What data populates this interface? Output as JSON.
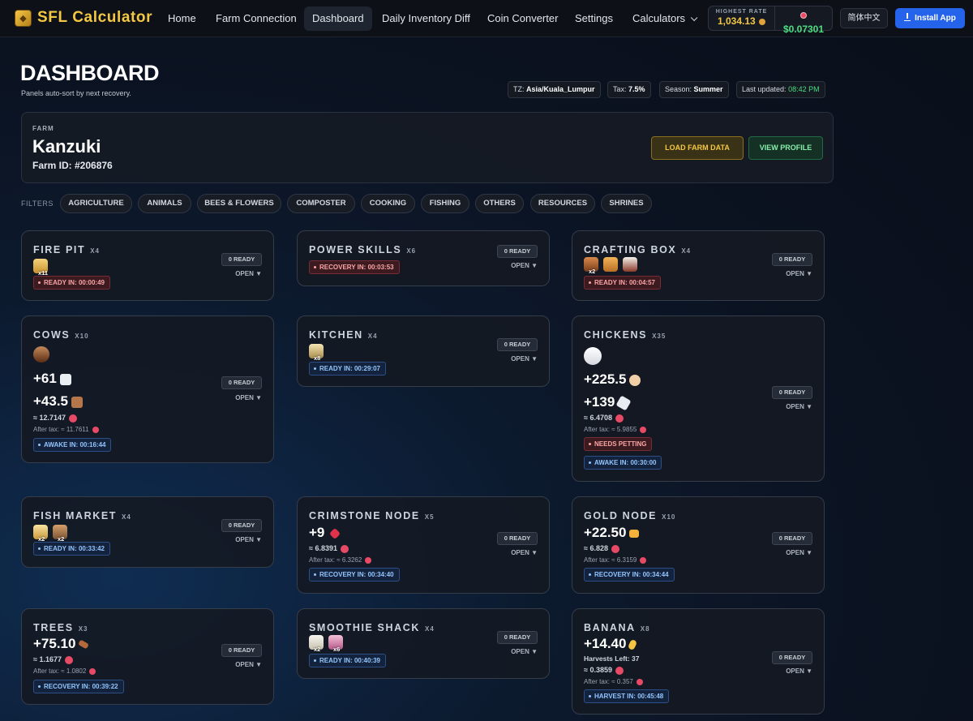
{
  "nav": {
    "logo": "SFL Calculator",
    "links": [
      "Home",
      "Farm Connection",
      "Dashboard",
      "Daily Inventory Diff",
      "Coin Converter",
      "Settings",
      "Calculators"
    ],
    "rate_label": "HIGHEST RATE",
    "rate_value": "1,034.13",
    "usd_value": "$0.07301",
    "lang": "简体中文",
    "install": "Install App"
  },
  "header": {
    "title": "DASHBOARD",
    "subtitle": "Panels auto-sort by next recovery.",
    "chips": {
      "tz_label": "TZ:",
      "tz": "Asia/Kuala_Lumpur",
      "tax_label": "Tax:",
      "tax": "7.5%",
      "season_label": "Season:",
      "season": "Summer",
      "updated_label": "Last updated:",
      "updated": "08:42 PM"
    }
  },
  "farm": {
    "label": "FARM",
    "name": "Kanzuki",
    "id": "Farm ID: #206876",
    "load_btn": "LOAD FARM DATA",
    "view_btn": "VIEW PROFILE"
  },
  "filters": {
    "label": "FILTERS",
    "items": [
      "AGRICULTURE",
      "ANIMALS",
      "BEES & FLOWERS",
      "COMPOSTER",
      "COOKING",
      "FISHING",
      "OTHERS",
      "RESOURCES",
      "SHRINES"
    ]
  },
  "panels": {
    "ready": "0 READY",
    "open": "OPEN ▼",
    "firepit": {
      "title": "FIRE PIT",
      "mult": "X4",
      "items": [
        {
          "icon": "food-bowl-icon",
          "qty": "x11"
        }
      ],
      "status": "READY IN: 00:00:49"
    },
    "power": {
      "title": "POWER SKILLS",
      "mult": "X6",
      "status": "RECOVERY IN: 00:03:53"
    },
    "crafting": {
      "title": "CRAFTING BOX",
      "mult": "X4",
      "items": [
        {
          "icon": "doll-icon",
          "qty": "x2"
        },
        {
          "icon": "bear-doll-icon",
          "qty": ""
        },
        {
          "icon": "figurine-icon",
          "qty": ""
        }
      ],
      "status": "READY IN: 00:04:57"
    },
    "cows": {
      "title": "COWS",
      "mult": "X10",
      "v1": "+61",
      "v2": "+43.5",
      "approx": "≈ 12.7147",
      "tax": "After tax: ≈ 11.7611",
      "status": "AWAKE IN: 00:16:44"
    },
    "kitchen": {
      "title": "KITCHEN",
      "mult": "X4",
      "items": [
        {
          "icon": "dish-icon",
          "qty": "x8"
        }
      ],
      "status": "READY IN: 00:29:07"
    },
    "chickens": {
      "title": "CHICKENS",
      "mult": "X35",
      "v1": "+225.5",
      "v2": "+139",
      "approx": "≈ 6.4708",
      "tax": "After tax: ≈ 5.9855",
      "status1": "NEEDS PETTING",
      "status2": "AWAKE IN: 00:30:00"
    },
    "fishmarket": {
      "title": "FISH MARKET",
      "mult": "X4",
      "items": [
        {
          "icon": "fish-dish-icon",
          "qty": "x2"
        },
        {
          "icon": "seafood-icon",
          "qty": "x2"
        }
      ],
      "status": "READY IN: 00:33:42"
    },
    "crimstone": {
      "title": "CRIMSTONE NODE",
      "mult": "X5",
      "v1": "+9",
      "approx": "≈ 6.8391",
      "tax": "After tax: ≈ 6.3262",
      "status": "RECOVERY IN: 00:34:40"
    },
    "gold": {
      "title": "GOLD NODE",
      "mult": "X10",
      "v1": "+22.50",
      "approx": "≈ 6.828",
      "tax": "After tax: ≈ 6.3159",
      "status": "RECOVERY IN: 00:34:44"
    },
    "trees": {
      "title": "TREES",
      "mult": "X3",
      "v1": "+75.10",
      "approx": "≈ 1.1677",
      "tax": "After tax: ≈ 1.0802",
      "status": "RECOVERY IN: 00:39:22"
    },
    "smoothie": {
      "title": "SMOOTHIE SHACK",
      "mult": "X4",
      "items": [
        {
          "icon": "juice-icon",
          "qty": "x2"
        },
        {
          "icon": "smoothie-icon",
          "qty": "x6"
        }
      ],
      "status": "READY IN: 00:40:39"
    },
    "banana": {
      "title": "BANANA",
      "mult": "X8",
      "v1": "+14.40",
      "harvests": "Harvests Left: 37",
      "approx": "≈ 0.3859",
      "tax": "After tax: ≈ 0.357",
      "status": "HARVEST IN: 00:45:48"
    }
  }
}
